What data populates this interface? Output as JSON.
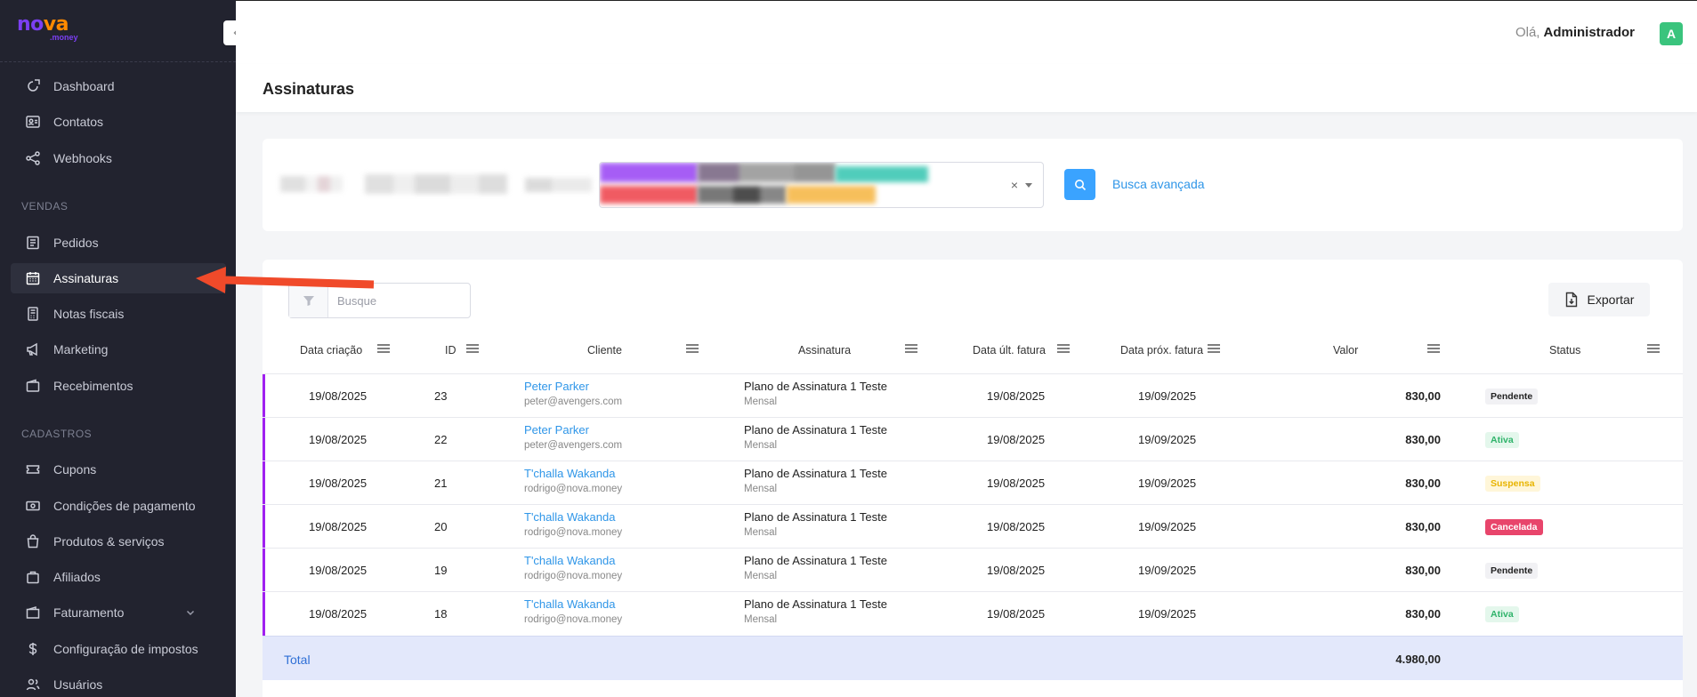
{
  "brand": {
    "logo_part1": "no",
    "logo_part2": "va",
    "logo_sub": ".money"
  },
  "sidebar": {
    "items_top": [
      {
        "label": "Dashboard",
        "icon": "dashboard-icon"
      },
      {
        "label": "Contatos",
        "icon": "contact-card-icon"
      },
      {
        "label": "Webhooks",
        "icon": "share-icon"
      }
    ],
    "section_vendas": "VENDAS",
    "items_vendas": [
      {
        "label": "Pedidos",
        "icon": "document-list-icon"
      },
      {
        "label": "Assinaturas",
        "icon": "calendar-icon"
      },
      {
        "label": "Notas fiscais",
        "icon": "receipt-icon"
      },
      {
        "label": "Marketing",
        "icon": "megaphone-icon"
      },
      {
        "label": "Recebimentos",
        "icon": "wallet-icon"
      }
    ],
    "section_cadastros": "CADASTROS",
    "items_cadastros": [
      {
        "label": "Cupons",
        "icon": "ticket-icon"
      },
      {
        "label": "Condições de pagamento",
        "icon": "money-icon"
      },
      {
        "label": "Produtos & serviços",
        "icon": "bag-icon"
      },
      {
        "label": "Afiliados",
        "icon": "briefcase-icon"
      },
      {
        "label": "Faturamento",
        "icon": "folder-icon"
      },
      {
        "label": "Configuração de impostos",
        "icon": "dollar-icon"
      },
      {
        "label": "Usuários",
        "icon": "users-icon"
      }
    ]
  },
  "header": {
    "greeting": "Olá,",
    "user": "Administrador",
    "avatar_letter": "A"
  },
  "page": {
    "title": "Assinaturas"
  },
  "filter": {
    "clear_symbol": "×",
    "advanced_link": "Busca avançada"
  },
  "table": {
    "search_placeholder": "Busque",
    "export_label": "Exportar",
    "columns": [
      "Data criação",
      "ID",
      "Cliente",
      "Assinatura",
      "Data últ. fatura",
      "Data próx. fatura",
      "Valor",
      "Status"
    ],
    "rows": [
      {
        "created": "19/08/2025",
        "id": "23",
        "client": "Peter Parker",
        "email": "peter@avengers.com",
        "plan": "Plano de Assinatura 1 Teste",
        "period": "Mensal",
        "last": "19/08/2025",
        "next": "19/09/2025",
        "value": "830,00",
        "status": "Pendente",
        "status_kind": "pendente"
      },
      {
        "created": "19/08/2025",
        "id": "22",
        "client": "Peter Parker",
        "email": "peter@avengers.com",
        "plan": "Plano de Assinatura 1 Teste",
        "period": "Mensal",
        "last": "19/08/2025",
        "next": "19/09/2025",
        "value": "830,00",
        "status": "Ativa",
        "status_kind": "ativa"
      },
      {
        "created": "19/08/2025",
        "id": "21",
        "client": "T'challa Wakanda",
        "email": "rodrigo@nova.money",
        "plan": "Plano de Assinatura 1 Teste",
        "period": "Mensal",
        "last": "19/08/2025",
        "next": "19/09/2025",
        "value": "830,00",
        "status": "Suspensa",
        "status_kind": "suspensa"
      },
      {
        "created": "19/08/2025",
        "id": "20",
        "client": "T'challa Wakanda",
        "email": "rodrigo@nova.money",
        "plan": "Plano de Assinatura 1 Teste",
        "period": "Mensal",
        "last": "19/08/2025",
        "next": "19/09/2025",
        "value": "830,00",
        "status": "Cancelada",
        "status_kind": "cancelada"
      },
      {
        "created": "19/08/2025",
        "id": "19",
        "client": "T'challa Wakanda",
        "email": "rodrigo@nova.money",
        "plan": "Plano de Assinatura 1 Teste",
        "period": "Mensal",
        "last": "19/08/2025",
        "next": "19/09/2025",
        "value": "830,00",
        "status": "Pendente",
        "status_kind": "pendente"
      },
      {
        "created": "19/08/2025",
        "id": "18",
        "client": "T'challa Wakanda",
        "email": "rodrigo@nova.money",
        "plan": "Plano de Assinatura 1 Teste",
        "period": "Mensal",
        "last": "19/08/2025",
        "next": "19/09/2025",
        "value": "830,00",
        "status": "Ativa",
        "status_kind": "ativa"
      }
    ],
    "total_label": "Total",
    "total_value": "4.980,00"
  },
  "colors": {
    "sidebar_bg": "#22232f",
    "accent_link": "#2f96e8",
    "row_accent": "#a020f0",
    "annotation_arrow": "#f04a2a",
    "badge_pendente": "#f1f1f4",
    "badge_ativa": "#e4f7ec",
    "badge_suspensa": "#fff6d9",
    "badge_cancelada": "#e8456b"
  }
}
